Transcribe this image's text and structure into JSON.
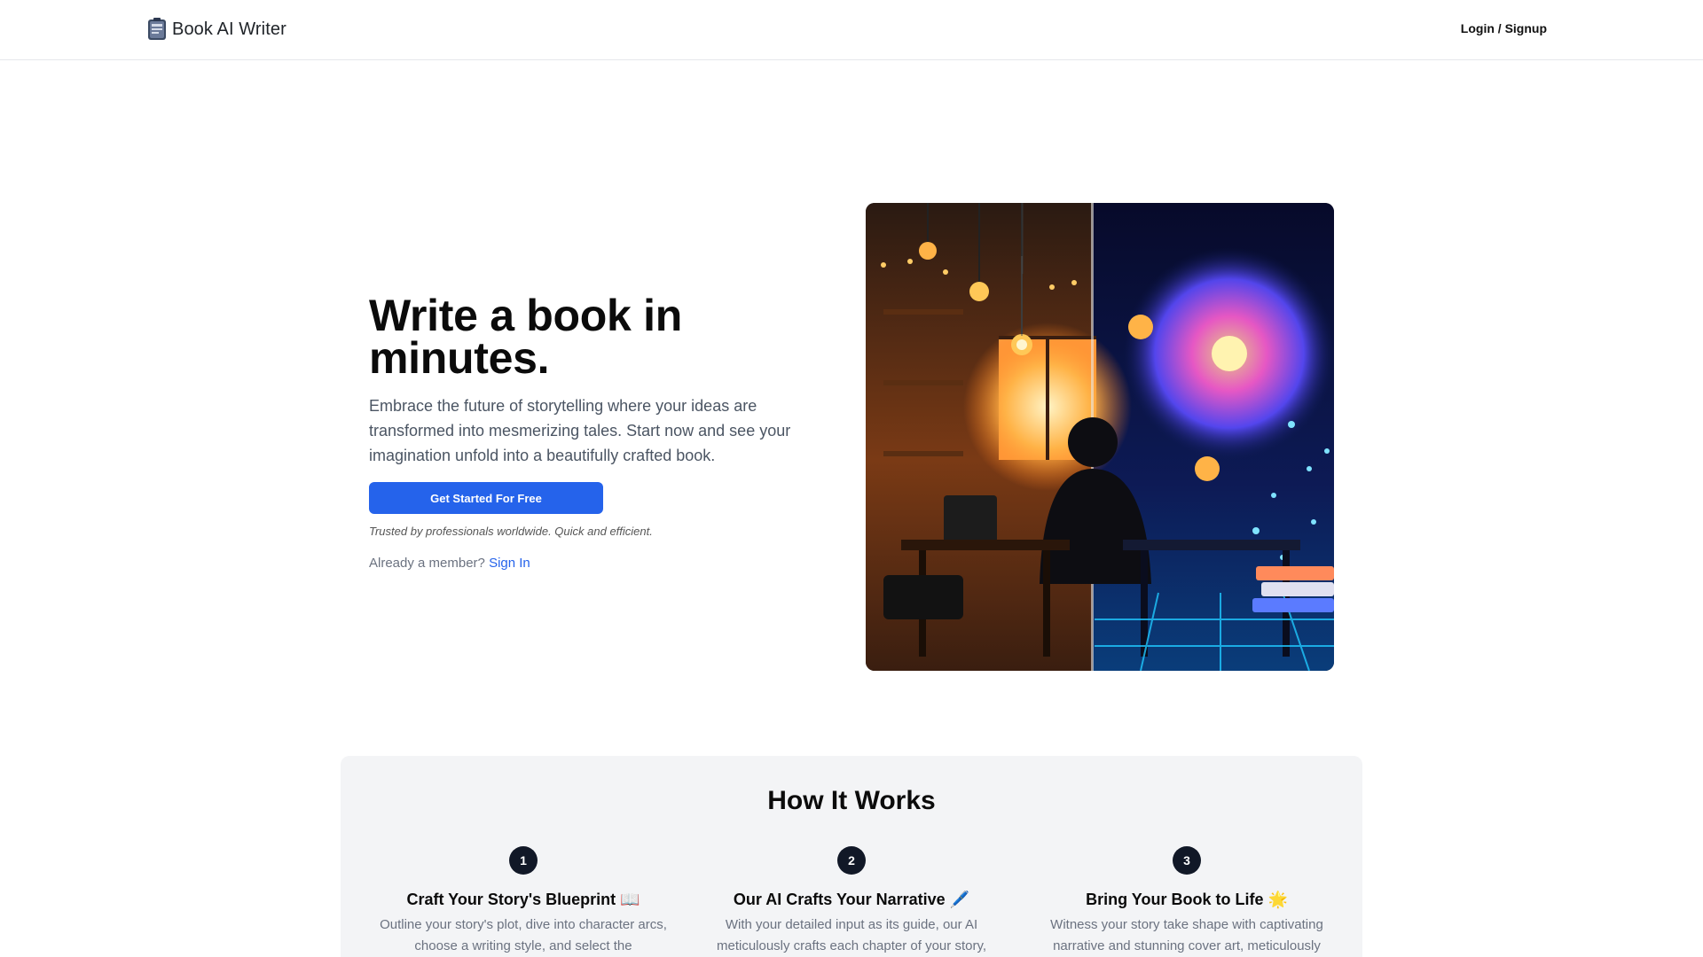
{
  "header": {
    "brand": "Book AI Writer",
    "login": "Login / Signup"
  },
  "hero": {
    "title_line1": "Write a book in",
    "title_line2": "minutes.",
    "subtitle": "Embrace the future of storytelling where your ideas are transformed into mesmerizing tales. Start now and see your imagination unfold into a beautifully crafted book.",
    "cta": "Get Started For Free",
    "trust": "Trusted by professionals worldwide. Quick and efficient.",
    "member_prompt": "Already a member?",
    "sign_in": "Sign In"
  },
  "how": {
    "title": "How It Works",
    "steps": [
      {
        "num": "1",
        "title": "Craft Your Story's Blueprint 📖",
        "desc": "Outline your story's plot, dive into character arcs, choose a writing style, and select the"
      },
      {
        "num": "2",
        "title": "Our AI Crafts Your Narrative 🖊️",
        "desc": "With your detailed input as its guide, our AI meticulously crafts each chapter of your story,"
      },
      {
        "num": "3",
        "title": "Bring Your Book to Life 🌟",
        "desc": "Witness your story take shape with captivating narrative and stunning cover art, meticulously"
      }
    ]
  }
}
